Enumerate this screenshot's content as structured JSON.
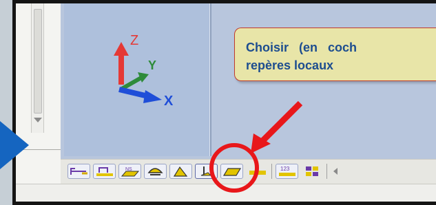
{
  "colors": {
    "callout_bg": "#e8e5a8",
    "callout_text": "#1d4d8f",
    "callout_border": "#c0392b",
    "annotation_red": "#e8171a",
    "viewport_bg": "#b8c6dd",
    "side_arrow": "#1565c0",
    "axis_x": "#1f4ed8",
    "axis_y": "#2e8b3a",
    "axis_z": "#e53935"
  },
  "axes": {
    "x_label": "X",
    "y_label": "Y",
    "z_label": "Z"
  },
  "callout": {
    "line1": "Choisir   (en   coch",
    "line2": "repères locaux"
  },
  "toolbar": {
    "buttons": [
      {
        "icon": "measure-angle-icon"
      },
      {
        "icon": "measure-distance-icon"
      },
      {
        "icon": "measure-element-icon"
      },
      {
        "icon": "section-view-icon"
      },
      {
        "icon": "display-style-icon"
      },
      {
        "icon": "local-axes-icon",
        "highlighted": true
      },
      {
        "icon": "local-plane-icon"
      },
      {
        "icon": "floor-icon"
      },
      {
        "icon": "numbering-icon",
        "text": "123"
      },
      {
        "icon": "grid-icon"
      }
    ]
  }
}
